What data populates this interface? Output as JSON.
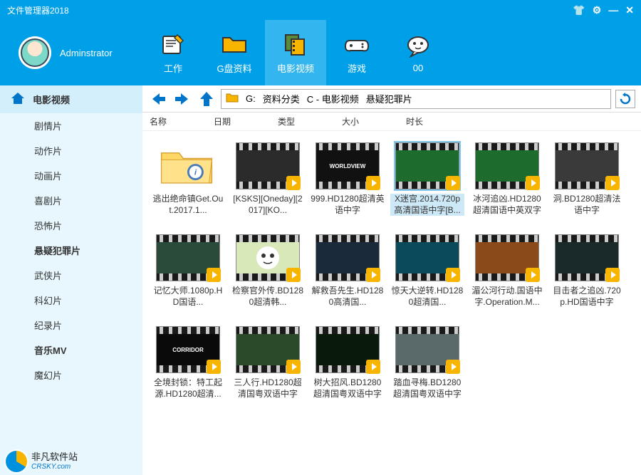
{
  "window": {
    "title": "文件管理器2018"
  },
  "user": {
    "name": "Adminstrator"
  },
  "tabs": [
    {
      "id": "work",
      "label": "工作",
      "icon": "notepad-icon"
    },
    {
      "id": "gdisk",
      "label": "G盘资料",
      "icon": "folder-icon"
    },
    {
      "id": "movies",
      "label": "电影视频",
      "icon": "film-icon",
      "active": true
    },
    {
      "id": "games",
      "label": "游戏",
      "icon": "gamepad-icon"
    },
    {
      "id": "oo",
      "label": "00",
      "icon": "chat-icon"
    }
  ],
  "sidebar": {
    "header": "电影视频",
    "items": [
      {
        "label": "剧情片"
      },
      {
        "label": "动作片"
      },
      {
        "label": "动画片"
      },
      {
        "label": "喜剧片"
      },
      {
        "label": "恐怖片"
      },
      {
        "label": "悬疑犯罪片",
        "bold": true
      },
      {
        "label": "武侠片"
      },
      {
        "label": "科幻片"
      },
      {
        "label": "纪录片"
      },
      {
        "label": "音乐MV",
        "bold": true
      },
      {
        "label": "魔幻片"
      }
    ]
  },
  "path": {
    "drive": "G:",
    "p1": "资料分类",
    "p2": "C - 电影视频",
    "p3": "悬疑犯罪片"
  },
  "columns": {
    "name": "名称",
    "date": "日期",
    "type": "类型",
    "size": "大小",
    "duration": "时长"
  },
  "items": [
    {
      "type": "folder",
      "label": "逃出绝命镇Get.Out.2017.1..."
    },
    {
      "type": "video",
      "label": "[KSKS][Oneday][2017][KO...",
      "bg": "#2b2b2b"
    },
    {
      "type": "video",
      "label": "999.HD1280超清英语中字",
      "bg": "#111",
      "text": "WORLDVIEW"
    },
    {
      "type": "video",
      "label": "X迷宫.2014.720p高清国语中字[B...",
      "bg": "#1e6b2e",
      "selected": true
    },
    {
      "type": "video",
      "label": "冰河追凶.HD1280超清国语中英双字",
      "bg": "#1e6b2e"
    },
    {
      "type": "video",
      "label": "洞.BD1280超清法语中字",
      "bg": "#3a3a3a"
    },
    {
      "type": "video",
      "label": "记忆大师.1080p.HD国语...",
      "bg": "#2a4a3a"
    },
    {
      "type": "video",
      "label": "检察官外传.BD1280超清韩...",
      "bg": "#d8e8b8",
      "face": true
    },
    {
      "type": "video",
      "label": "解救吾先生.HD1280高清国...",
      "bg": "#1a2a3a"
    },
    {
      "type": "video",
      "label": "惊天大逆转.HD1280超清国...",
      "bg": "#0a4a5a"
    },
    {
      "type": "video",
      "label": "湄公河行动.国语中字.Operation.M...",
      "bg": "#8a4a1a"
    },
    {
      "type": "video",
      "label": "目击者之追凶.720p.HD国语中字",
      "bg": "#1a2a2a"
    },
    {
      "type": "video",
      "label": "全境封锁：特工起源.HD1280超清...",
      "bg": "#0a0a0a",
      "text": "CORRIDOR"
    },
    {
      "type": "video",
      "label": "三人行.HD1280超清国粤双语中字",
      "bg": "#2a4a2a"
    },
    {
      "type": "video",
      "label": "树大招风.BD1280超清国粤双语中字",
      "bg": "#0a1a0a"
    },
    {
      "type": "video",
      "label": "踏血寻梅.BD1280超清国粤双语中字",
      "bg": "#5a6a6a"
    }
  ],
  "watermark": {
    "line1": "非凡软件站",
    "line2": "CRSKY.com"
  }
}
